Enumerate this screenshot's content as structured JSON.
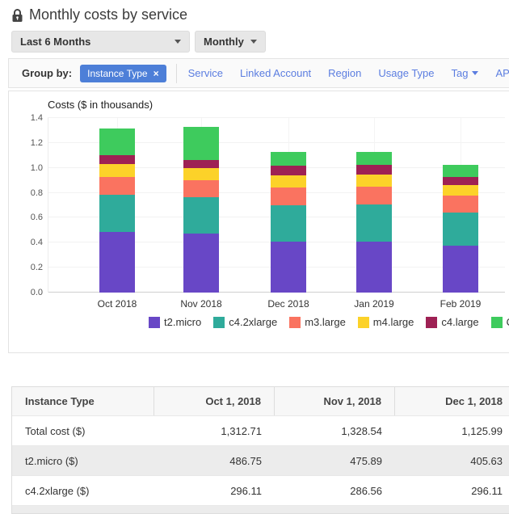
{
  "header": {
    "title": "Monthly costs by service"
  },
  "filters": {
    "date_range": "Last 6 Months",
    "granularity": "Monthly"
  },
  "group_by": {
    "label": "Group by:",
    "active_pill": {
      "label": "Instance Type",
      "remove": "×"
    },
    "options": [
      {
        "label": "Service",
        "caret": false
      },
      {
        "label": "Linked Account",
        "caret": false
      },
      {
        "label": "Region",
        "caret": false
      },
      {
        "label": "Usage Type",
        "caret": false
      },
      {
        "label": "Tag",
        "caret": true
      },
      {
        "label": "API Operation",
        "caret": false
      }
    ]
  },
  "chart_data": {
    "type": "bar",
    "stacked": true,
    "title": "Costs ($ in thousands)",
    "categories": [
      "Oct 2018",
      "Nov 2018",
      "Dec 2018",
      "Jan 2019",
      "Feb 2019"
    ],
    "series": [
      {
        "name": "t2.micro",
        "color": "#6847c6",
        "values": [
          486.75,
          475.89,
          405.63,
          411.0,
          376.0
        ]
      },
      {
        "name": "c4.2xlarge",
        "color": "#2fab9b",
        "values": [
          296.11,
          286.56,
          296.11,
          295.0,
          266.0
        ]
      },
      {
        "name": "m3.large",
        "color": "#fa7360",
        "values": [
          143.85,
          135.5,
          141.0,
          140.0,
          139.0
        ]
      },
      {
        "name": "m4.large",
        "color": "#fcd229",
        "values": [
          103.0,
          100.0,
          100.0,
          100.0,
          81.0
        ]
      },
      {
        "name": "c4.large",
        "color": "#9e2154",
        "values": [
          75.0,
          68.0,
          75.0,
          75.0,
          65.0
        ]
      },
      {
        "name": "Others",
        "color": "#3ecb5d",
        "values": [
          208.0,
          262.59,
          108.25,
          107.0,
          97.0
        ]
      }
    ],
    "totals": [
      1312.71,
      1328.54,
      1125.99,
      1128.0,
      1024.0
    ],
    "unit_divisor": 1000,
    "ylim": [
      0,
      1.4
    ],
    "yticks": [
      0.0,
      0.2,
      0.4,
      0.6,
      0.8,
      1.0,
      1.2,
      1.4
    ],
    "grid": true,
    "legend_position": "bottom"
  },
  "table": {
    "columns": [
      "Instance Type",
      "Oct 1, 2018",
      "Nov 1, 2018",
      "Dec 1, 2018"
    ],
    "rows": [
      [
        "Total cost ($)",
        "1,312.71",
        "1,328.54",
        "1,125.99"
      ],
      [
        "t2.micro ($)",
        "486.75",
        "475.89",
        "405.63"
      ],
      [
        "c4.2xlarge ($)",
        "296.11",
        "286.56",
        "296.11"
      ]
    ]
  },
  "colors": {
    "accent_blue": "#4d7fd8",
    "link_blue": "#5b7de0"
  }
}
